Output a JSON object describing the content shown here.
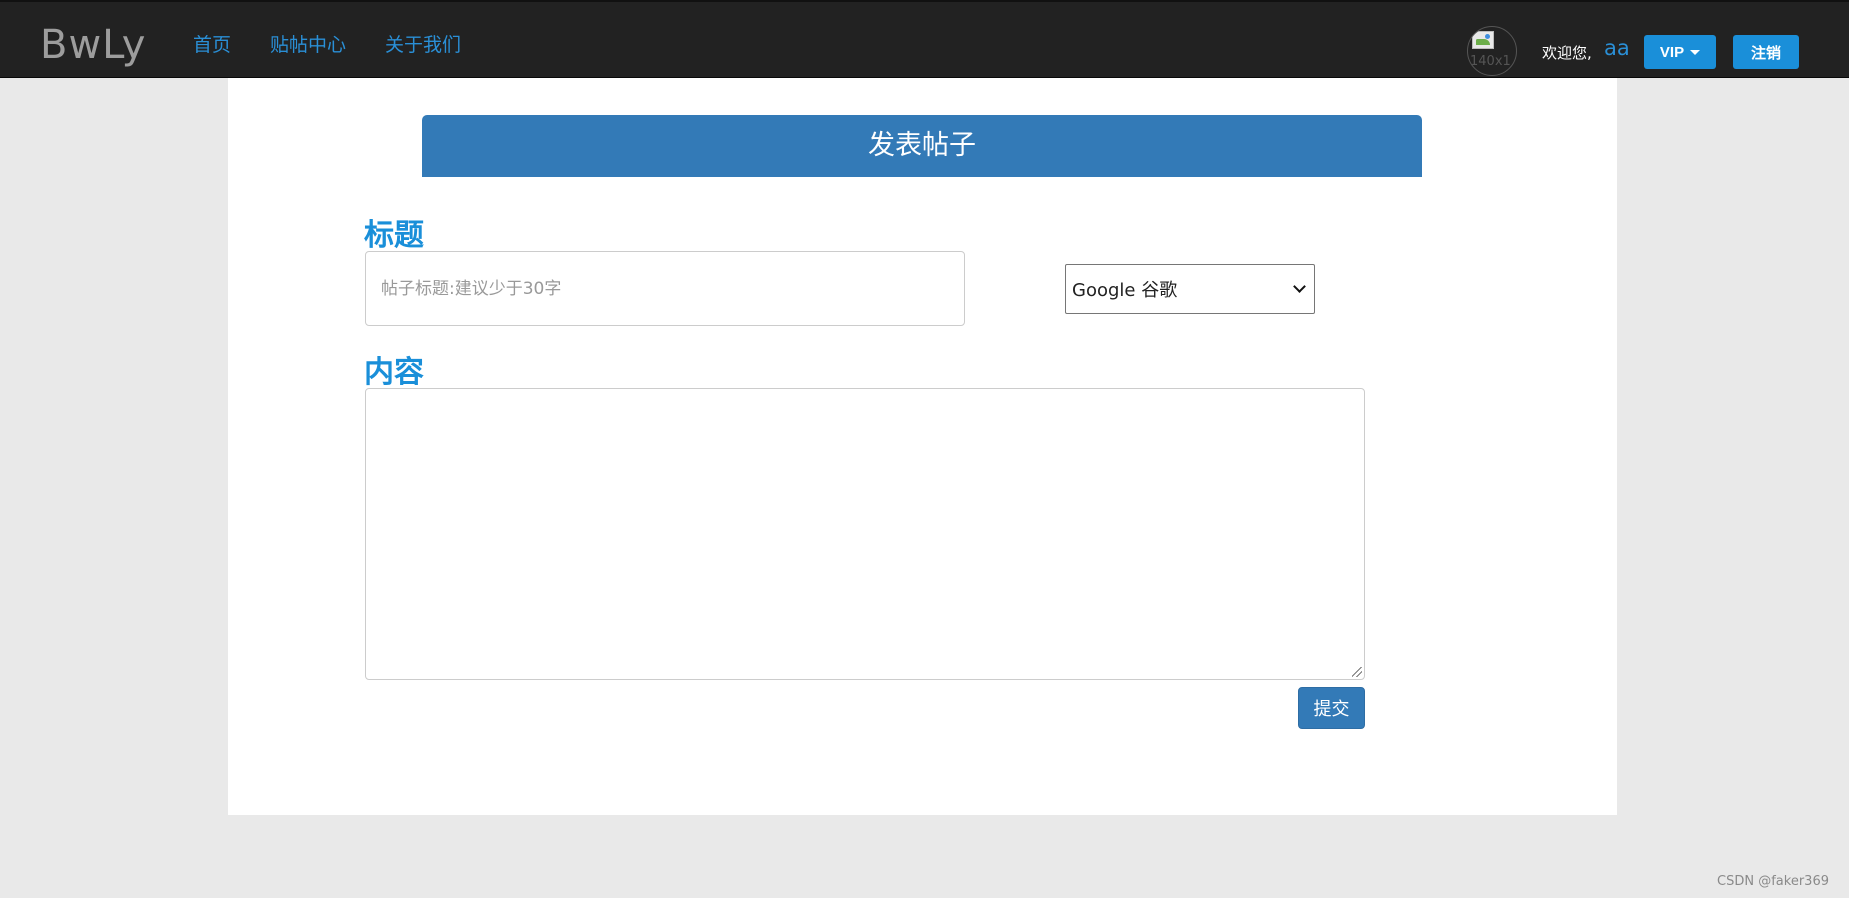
{
  "navbar": {
    "brand": "BwLy",
    "links": [
      {
        "label": "首页"
      },
      {
        "label": "贴帖中心"
      },
      {
        "label": "关于我们"
      }
    ],
    "avatar_alt": "140x1",
    "welcome_text": "欢迎您,",
    "username": "aa",
    "vip_label": "VIP",
    "logout_label": "注销"
  },
  "form": {
    "heading": "发表帖子",
    "title_label": "标题",
    "title_placeholder": "帖子标题:建议少于30字",
    "title_value": "",
    "category_selected": "Google 谷歌",
    "content_label": "内容",
    "content_value": "",
    "submit_label": "提交"
  },
  "watermark": "CSDN @faker369",
  "colors": {
    "navbar_bg": "#222222",
    "accent_blue": "#1a8fd9",
    "panel_blue": "#337ab7",
    "page_bg": "#e9e9e9"
  }
}
